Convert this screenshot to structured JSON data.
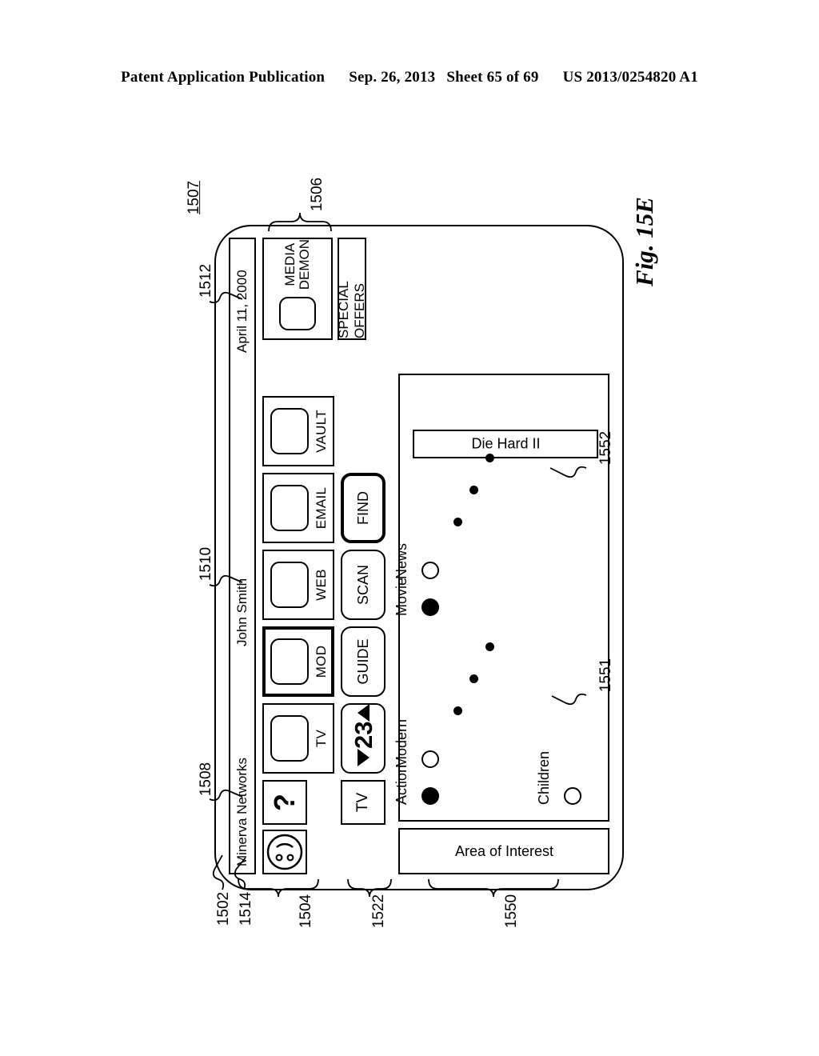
{
  "header": {
    "publication": "Patent Application Publication",
    "date": "Sep. 26, 2013",
    "sheet": "Sheet 65 of 69",
    "number": "US 2013/0254820 A1"
  },
  "figure": {
    "caption": "Fig. 15E"
  },
  "device": {
    "titlebar": {
      "brand": "Minerva Networks",
      "user": "John Smith",
      "date": "April 11, 2000"
    },
    "icon_row": {
      "smiley_icon": "smiley-face-icon",
      "help_label": "?",
      "tiles": [
        {
          "label": "TV",
          "selected": false
        },
        {
          "label": "MOD",
          "selected": true
        },
        {
          "label": "WEB",
          "selected": false
        },
        {
          "label": "EMAIL",
          "selected": false
        },
        {
          "label": "VAULT",
          "selected": false
        }
      ]
    },
    "control_row": {
      "tv_label": "TV",
      "channel": "23",
      "up_icon": "triangle-up-icon",
      "down_icon": "triangle-down-icon",
      "buttons": [
        {
          "label": "GUIDE",
          "selected": false
        },
        {
          "label": "SCAN",
          "selected": false
        },
        {
          "label": "FIND",
          "selected": true
        }
      ]
    },
    "promo": {
      "media_demon_line1": "MEDIA",
      "media_demon_line2": "DEMON",
      "special_offers": "SPECIAL OFFERS"
    },
    "area_of_interest": {
      "tab_label": "Area of Interest",
      "selection_label": "Die Hard II"
    }
  },
  "chart_data": {
    "type": "scatter",
    "title": "Area of Interest",
    "xlabel": "",
    "ylabel": "",
    "grid": false,
    "legend": "inline-labels",
    "annotations": [
      "Die Hard II"
    ],
    "series": [
      {
        "name": "row-1",
        "points": [
          {
            "label": "Action",
            "marker": "filled",
            "x": 30,
            "y": 38
          },
          {
            "label": "Modern",
            "marker": "hollow",
            "x": 76,
            "y": 38
          },
          {
            "label": "",
            "marker": "small",
            "x": 136,
            "y": 72
          },
          {
            "label": "",
            "marker": "small",
            "x": 176,
            "y": 92
          },
          {
            "label": "",
            "marker": "small",
            "x": 216,
            "y": 112
          },
          {
            "label": "Children",
            "marker": "hollow",
            "x": 30,
            "y": 216
          }
        ]
      },
      {
        "name": "row-2",
        "points": [
          {
            "label": "Movie",
            "marker": "filled",
            "x": 266,
            "y": 38
          },
          {
            "label": "News",
            "marker": "hollow",
            "x": 312,
            "y": 38
          },
          {
            "label": "",
            "marker": "small",
            "x": 372,
            "y": 72
          },
          {
            "label": "",
            "marker": "small",
            "x": 412,
            "y": 92
          },
          {
            "label": "",
            "marker": "small",
            "x": 452,
            "y": 112
          }
        ]
      }
    ]
  },
  "reference_numerals": {
    "screen": "1507",
    "promo_group": "1506",
    "date_field": "1512",
    "user_field": "1510",
    "brand_field": "1508",
    "device": "1502",
    "smiley": "1514",
    "icon_row": "1504",
    "control_row": "1522",
    "aoi_panel": "1550",
    "aoi_dots": "1551",
    "aoi_selection": "1552"
  }
}
